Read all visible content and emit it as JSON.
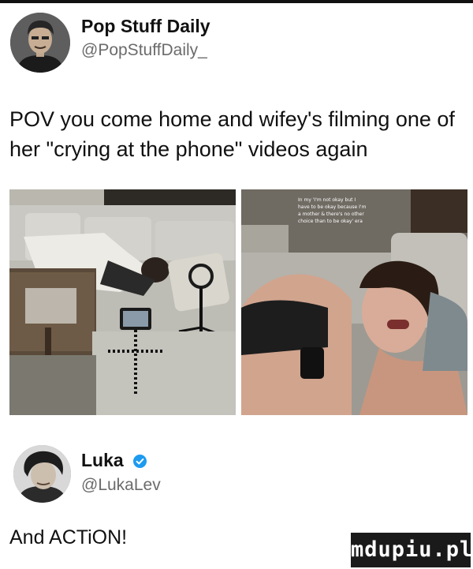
{
  "tweet": {
    "author": {
      "name": "Pop Stuff Daily",
      "handle": "@PopStuffDaily_"
    },
    "text": "POV you come home and wifey's filming one of her \"crying at the phone\" videos again",
    "media": [
      {
        "description_icon": "photo-couch-woman-tripod-icon"
      },
      {
        "description_icon": "photo-crying-selfie-icon",
        "overlay_text": "In my 'I'm not okay but I have to be okay because I'm a mother & there's no other choice than to be okay' era"
      }
    ]
  },
  "reply": {
    "author": {
      "name": "Luka",
      "handle": "@LukaLev",
      "verified": true
    },
    "text": "And ACTiON!"
  },
  "watermark": {
    "text": "mdupiu.pl"
  },
  "colors": {
    "verified": "#1d9bf0",
    "text": "#111111",
    "handle": "#6b6b6b"
  }
}
